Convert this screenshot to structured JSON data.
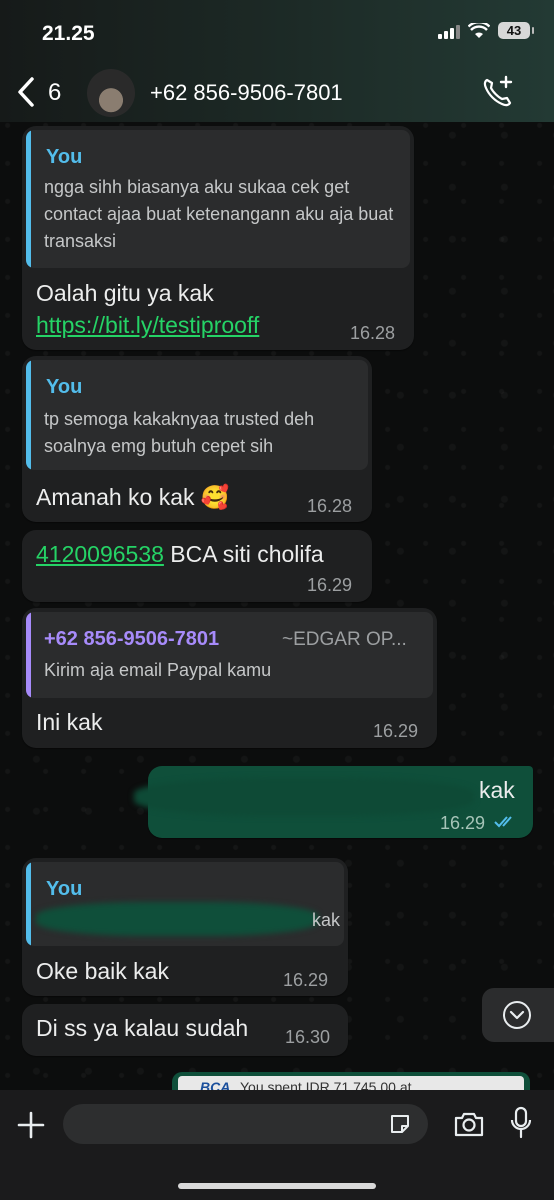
{
  "status_bar": {
    "time": "21.25",
    "battery": "43"
  },
  "header": {
    "back_count": "6",
    "contact_name": "+62 856-9506-7801"
  },
  "messages": [
    {
      "quote_author": "You",
      "quote_text": "ngga sihh biasanya aku sukaa cek get contact ajaa buat ketenangann aku aja buat transaksi",
      "text": "Oalah gitu ya kak",
      "link": "https://bit.ly/testiprooff",
      "time": "16.28"
    },
    {
      "quote_author": "You",
      "quote_text": "tp semoga kakaknyaa trusted deh soalnya emg butuh cepet sih",
      "text": "Amanah ko kak 🥰",
      "time": "16.28"
    },
    {
      "link": "4120096538",
      "text": " BCA siti cholifa",
      "time": "16.29"
    },
    {
      "quote_author": "+62 856-9506-7801",
      "quote_author_extra": "~EDGAR OP...",
      "quote_text": "Kirim aja email Paypal kamu",
      "text": "Ini kak",
      "time": "16.29"
    },
    {
      "text": "kak",
      "time": "16.29",
      "outgoing": true
    },
    {
      "quote_author": "You",
      "quote_text": "kak",
      "text": "Oke baik kak",
      "time": "16.29"
    },
    {
      "text": "Di ss ya kalau sudah",
      "time": "16.30"
    }
  ],
  "preview": {
    "bank": "BCA",
    "text": "You spent IDR 71,745.00 at"
  },
  "colors": {
    "link": "#25d366",
    "you": "#53bdeb",
    "contact": "#a78bfa",
    "outgoing": "#0f4f3a",
    "incoming": "#1f2021"
  },
  "icons": [
    "back-arrow-icon",
    "call-add-icon",
    "plus-icon",
    "sticker-icon",
    "camera-icon",
    "mic-icon",
    "chevron-down-icon",
    "read-ticks-icon"
  ]
}
